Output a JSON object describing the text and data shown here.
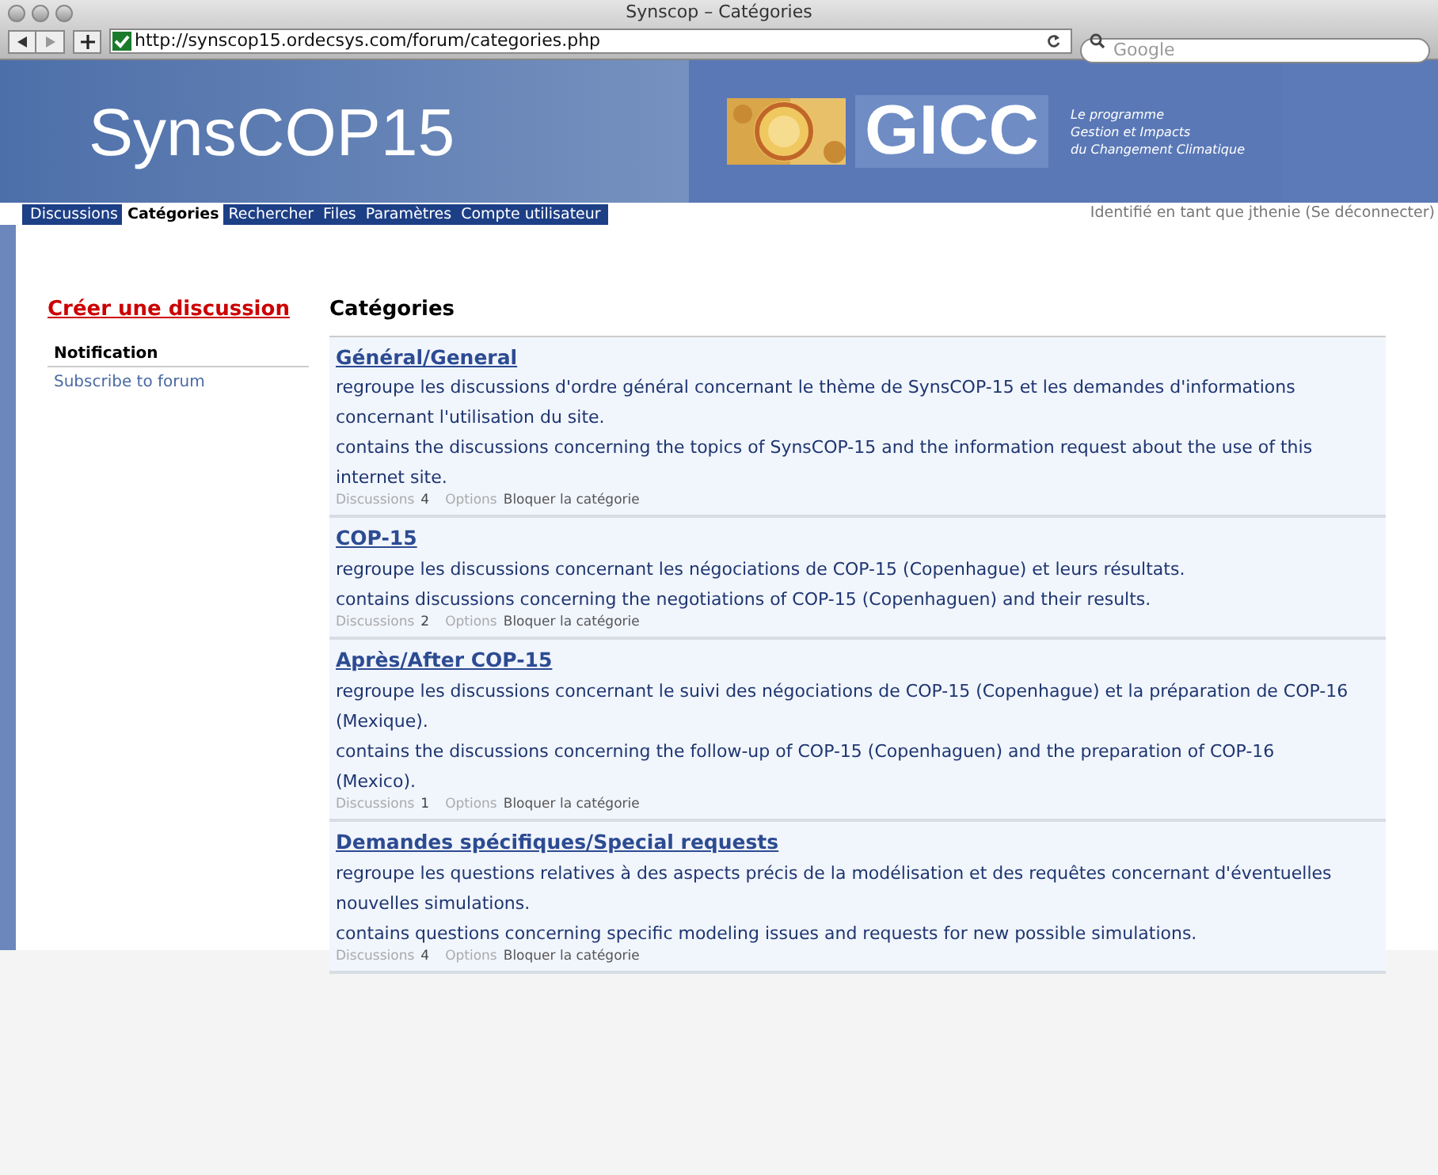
{
  "window": {
    "title": "Synscop – Catégories"
  },
  "toolbar": {
    "url": "http://synscop15.ordecsys.com/forum/categories.php",
    "search": {
      "placeholder": "Google"
    }
  },
  "header": {
    "site_title": "SynsCOP15",
    "logo_text": "GICC",
    "logo_caption": [
      "Le programme",
      "Gestion et Impacts",
      "du Changement Climatique"
    ]
  },
  "nav": {
    "items": [
      {
        "label": "Discussions",
        "selected": false
      },
      {
        "label": "Catégories",
        "selected": true
      },
      {
        "label": "Rechercher",
        "selected": false
      },
      {
        "label": "Files",
        "selected": false
      },
      {
        "label": "Paramètres",
        "selected": false
      },
      {
        "label": "Compte utilisateur",
        "selected": false
      }
    ],
    "user_status": "Identifié en tant que jthenie (Se déconnecter)"
  },
  "sidebar": {
    "create_link": "Créer une discussion",
    "section_title": "Notification",
    "links": [
      "Subscribe to forum"
    ]
  },
  "main": {
    "title": "Catégories",
    "categories": [
      {
        "name": "Général/General",
        "descriptions": [
          "regroupe les discussions d'ordre général concernant le thème de SynsCOP-15 et les demandes d'informations concernant l'utilisation du site.",
          "contains the discussions concerning the topics of SynsCOP-15 and the information request about the use of this internet site."
        ],
        "discussions_label": "Discussions",
        "discussions_count": "4",
        "options_label": "Options",
        "option_link": "Bloquer la catégorie"
      },
      {
        "name": "COP-15",
        "descriptions": [
          "regroupe les discussions concernant les négociations de COP-15 (Copenhague) et leurs résultats.",
          "contains discussions concerning the negotiations of COP-15 (Copenhaguen) and their results."
        ],
        "discussions_label": "Discussions",
        "discussions_count": "2",
        "options_label": "Options",
        "option_link": "Bloquer la catégorie"
      },
      {
        "name": "Après/After COP-15",
        "descriptions": [
          "regroupe les discussions concernant le suivi des négociations de COP-15 (Copenhague) et la préparation de COP-16 (Mexique).",
          "contains the discussions concerning the follow-up of COP-15 (Copenhaguen) and the preparation of COP-16 (Mexico)."
        ],
        "discussions_label": "Discussions",
        "discussions_count": "1",
        "options_label": "Options",
        "option_link": "Bloquer la catégorie"
      },
      {
        "name": "Demandes spécifiques/Special requests",
        "descriptions": [
          "regroupe les questions relatives à des aspects précis de la modélisation et des requêtes concernant d'éventuelles nouvelles simulations.",
          "contains questions concerning specific modeling issues and requests for new possible simulations."
        ],
        "discussions_label": "Discussions",
        "discussions_count": "4",
        "options_label": "Options",
        "option_link": "Bloquer la catégorie"
      }
    ]
  }
}
